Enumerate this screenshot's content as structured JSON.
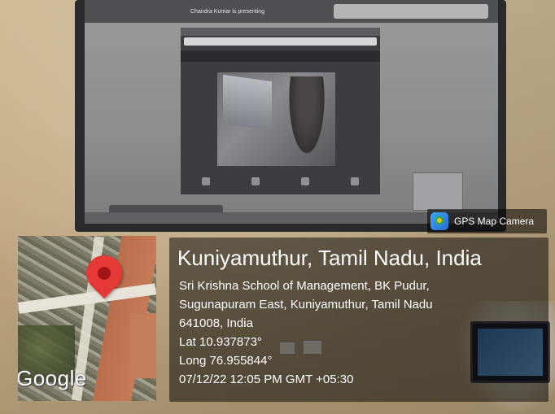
{
  "badge": {
    "label": "GPS Map Camera",
    "icon": "gps-map-camera-icon"
  },
  "location": {
    "title": "Kuniyamuthur, Tamil Nadu, India",
    "address_lines": [
      "Sri Krishna School of Management, BK Pudur,",
      "Sugunapuram East, Kuniyamuthur, Tamil Nadu",
      "641008, India"
    ],
    "lat": "Lat 10.937873°",
    "long": "Long 76.955844°",
    "datetime": "07/12/22 12:05 PM GMT +05:30"
  },
  "map": {
    "attribution": "Google",
    "pin_color": "#e53935"
  },
  "screen": {
    "presenting_text": "Chandra Kumar is presenting"
  }
}
